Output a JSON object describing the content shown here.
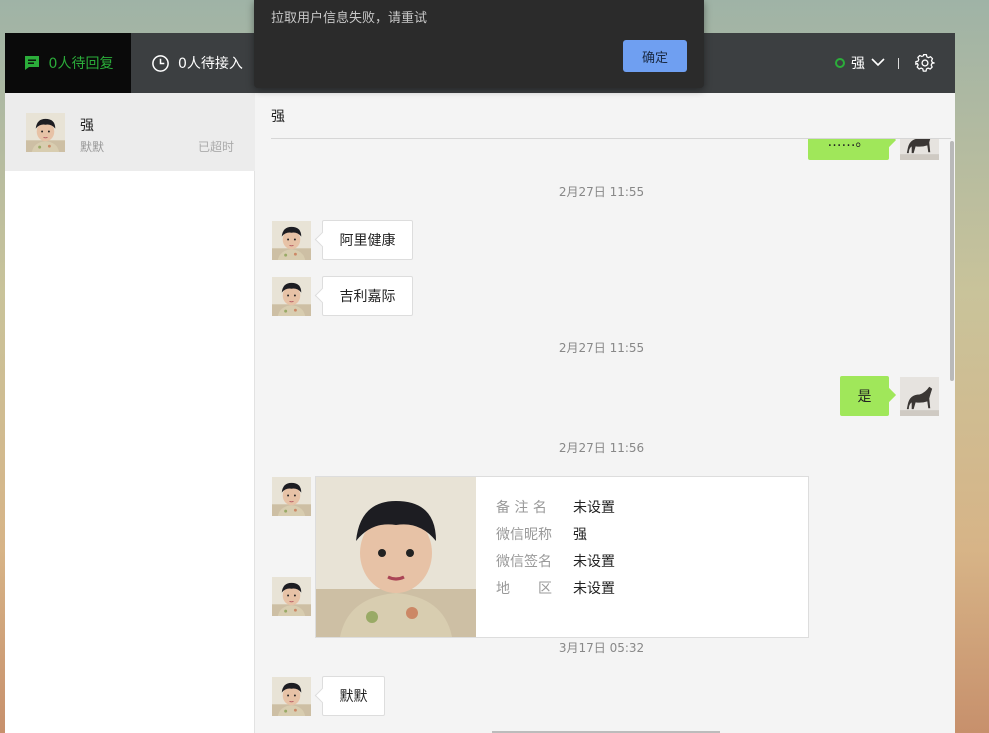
{
  "topbar": {
    "tab_pending_reply": "0人待回复",
    "tab_pending_accept": "0人待接入",
    "user_name": "强"
  },
  "sidebar": {
    "session": {
      "name": "强",
      "preview": "默默",
      "state": "已超时"
    }
  },
  "chat": {
    "title": "强",
    "partial_message": "……。",
    "timestamps": [
      "2月27日 11:55",
      "2月27日 11:55",
      "2月27日 11:56",
      "3月17日 05:32"
    ],
    "msg_1": "阿里健康",
    "msg_2": "吉利嘉际",
    "msg_3": "是",
    "msg_4": "默默",
    "card": {
      "rows": [
        {
          "label": "备 注 名",
          "value": "未设置"
        },
        {
          "label": "微信昵称",
          "value": "强"
        },
        {
          "label": "微信签名",
          "value": "未设置"
        },
        {
          "label": "地　　区",
          "value": "未设置"
        }
      ]
    }
  },
  "dialog": {
    "message": "拉取用户信息失败，请重试",
    "ok_label": "确定"
  },
  "colors": {
    "accent_green": "#2bad3a",
    "bubble_green": "#a0e75a",
    "button_blue": "#6f9ff1",
    "topbar": "#3c3f41"
  },
  "icons": [
    "chat-bubble-icon",
    "clock-icon",
    "status-ring-icon",
    "chevron-down-icon",
    "gear-icon"
  ]
}
